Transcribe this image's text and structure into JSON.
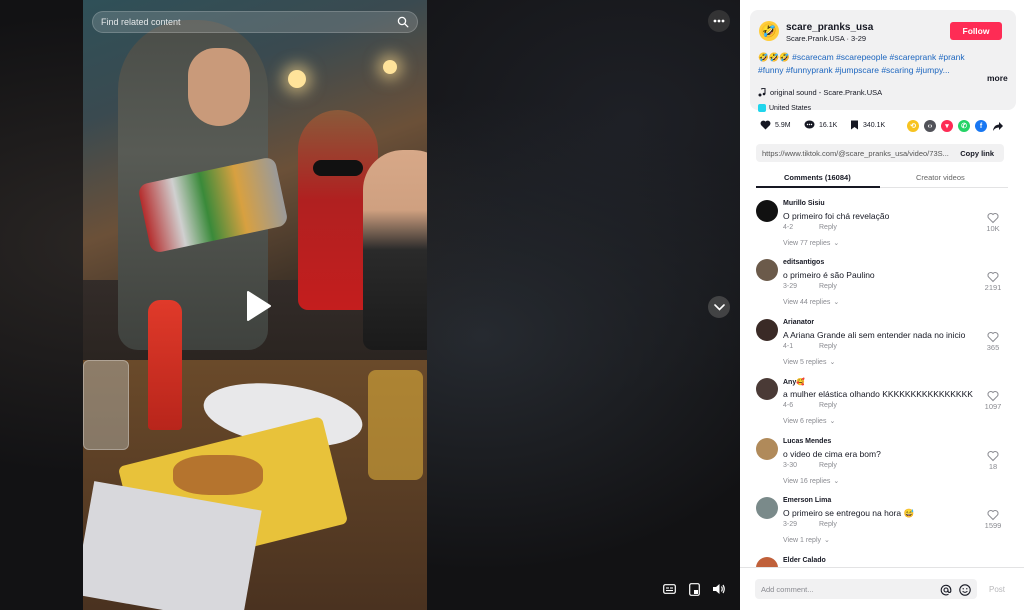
{
  "search": {
    "placeholder": "Find related content"
  },
  "author": {
    "avatar_emoji": "🤣",
    "username": "scare_pranks_usa",
    "subtitle": "Scare.Prank.USA · 3-29",
    "follow_label": "Follow"
  },
  "caption": {
    "emojis": "🤣🤣🤣",
    "hashtags_line1": "#scarecam #scarepeople #scareprank #prank",
    "hashtags_line2": "#funny #funnyprank #jumpscare #scaring #jumpy...",
    "more_label": "more",
    "sound": "original sound - Scare.Prank.USA",
    "region": "United States"
  },
  "stats": {
    "likes": "5.9M",
    "comments": "16.1K",
    "saves": "340.1K"
  },
  "share_icons": [
    "repost-icon",
    "embed-icon",
    "send-icon",
    "whatsapp-icon",
    "facebook-icon",
    "share-arrow-icon"
  ],
  "link": {
    "url": "https://www.tiktok.com/@scare_pranks_usa/video/73S...",
    "copy_label": "Copy link"
  },
  "tabs": {
    "comments": "Comments (16084)",
    "creator_videos": "Creator videos"
  },
  "comments": [
    {
      "name": "Murillo Sisiu",
      "text": "O primeiro foi chá revelação",
      "date": "4-2",
      "reply": "Reply",
      "likes": "10K",
      "views": "View 77 replies",
      "avatar_color": "#111111"
    },
    {
      "name": "editsantigos",
      "text": "o primeiro é são Paulino",
      "date": "3-29",
      "reply": "Reply",
      "likes": "2191",
      "views": "View 44 replies",
      "avatar_color": "#6b5a4a"
    },
    {
      "name": "Arianator",
      "text": "A Ariana Grande ali sem entender nada no inicio",
      "date": "4-1",
      "reply": "Reply",
      "likes": "365",
      "views": "View 5 replies",
      "avatar_color": "#3a2a26"
    },
    {
      "name": "Any🥰",
      "text": "a mulher elástica olhando KKKKKKKKKKKKKKKK",
      "date": "4-6",
      "reply": "Reply",
      "likes": "1097",
      "views": "View 6 replies",
      "avatar_color": "#4a3a36"
    },
    {
      "name": "Lucas Mendes",
      "text": "o video de cima era bom?",
      "date": "3-30",
      "reply": "Reply",
      "likes": "18",
      "views": "View 16 replies",
      "avatar_color": "#b08a5a"
    },
    {
      "name": "Emerson Lima",
      "text": "O primeiro se entregou na hora 😅",
      "date": "3-29",
      "reply": "Reply",
      "likes": "1599",
      "views": "View 1 reply",
      "avatar_color": "#7a8a8a"
    },
    {
      "name": "Elder Calado",
      "text": "",
      "date": "",
      "reply": "",
      "likes": "",
      "views": "",
      "avatar_color": "#c0603a"
    }
  ],
  "composer": {
    "placeholder": "Add comment...",
    "post_label": "Post"
  },
  "colors": {
    "accent": "#fe2c55",
    "hashtag": "#1d66bf"
  }
}
